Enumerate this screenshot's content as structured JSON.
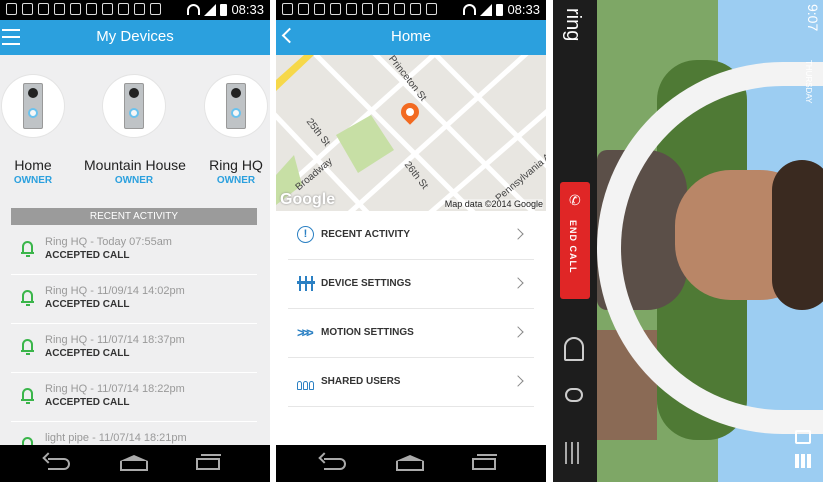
{
  "status_bar": {
    "time": "08:33"
  },
  "screen1": {
    "title": "My Devices",
    "devices": [
      {
        "name": "Home",
        "role": "OWNER"
      },
      {
        "name": "Mountain House",
        "role": "OWNER"
      },
      {
        "name": "Ring HQ",
        "role": "OWNER"
      }
    ],
    "recent_header": "RECENT ACTIVITY",
    "activity": [
      {
        "line1": "Ring HQ - Today 07:55am",
        "line2": "ACCEPTED CALL"
      },
      {
        "line1": "Ring HQ - 11/09/14 14:02pm",
        "line2": "ACCEPTED CALL"
      },
      {
        "line1": "Ring HQ - 11/07/14 18:37pm",
        "line2": "ACCEPTED CALL"
      },
      {
        "line1": "Ring HQ - 11/07/14 18:22pm",
        "line2": "ACCEPTED CALL"
      },
      {
        "line1": "light pipe - 11/07/14 18:21pm",
        "line2": ""
      }
    ]
  },
  "screen2": {
    "title": "Home",
    "map": {
      "streets": [
        "Princeton St",
        "25th St",
        "26th St",
        "Broadway",
        "Pennsylvania Ave"
      ],
      "attribution": "Map data ©2014 Google",
      "logo": "Google"
    },
    "menu": [
      {
        "label": "RECENT ACTIVITY",
        "icon": "info-icon"
      },
      {
        "label": "DEVICE SETTINGS",
        "icon": "sliders-icon"
      },
      {
        "label": "MOTION SETTINGS",
        "icon": "motion-icon"
      },
      {
        "label": "SHARED USERS",
        "icon": "users-icon"
      }
    ]
  },
  "screen3": {
    "logo": "ring",
    "end_call": "END CALL",
    "video_time": "9:07",
    "video_label": "THURSDAY"
  },
  "colors": {
    "accent": "#2ba0de",
    "end_call": "#e02626",
    "bell": "#3ab54a",
    "pin": "#f26a21"
  }
}
